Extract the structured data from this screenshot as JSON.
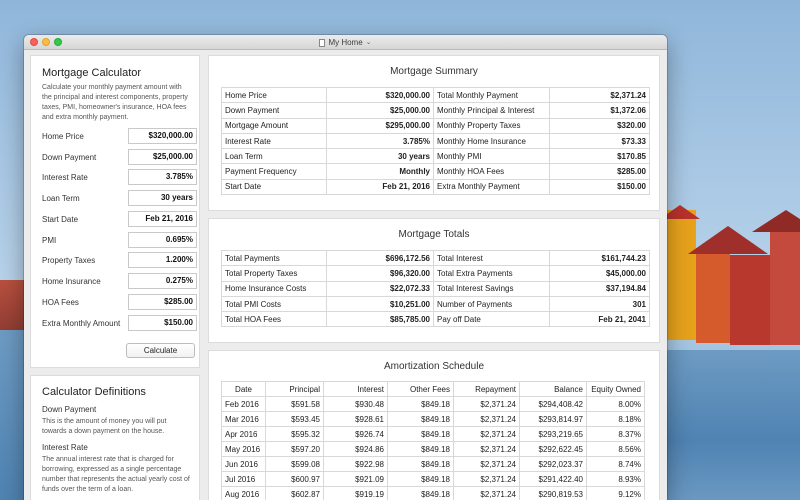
{
  "window": {
    "title": "My Home"
  },
  "calculator": {
    "title": "Mortgage Calculator",
    "description": "Calculate your monthly payment amount with the principal and interest components, property taxes, PMI, homeowner's insurance, HOA fees and extra monthly payment.",
    "fields": [
      {
        "label": "Home Price",
        "value": "$320,000.00"
      },
      {
        "label": "Down Payment",
        "value": "$25,000.00"
      },
      {
        "label": "Interest Rate",
        "value": "3.785%"
      },
      {
        "label": "Loan Term",
        "value": "30 years"
      },
      {
        "label": "Start Date",
        "value": "Feb 21, 2016"
      },
      {
        "label": "PMI",
        "value": "0.695%"
      },
      {
        "label": "Property Taxes",
        "value": "1.200%"
      },
      {
        "label": "Home Insurance",
        "value": "0.275%"
      },
      {
        "label": "HOA Fees",
        "value": "$285.00"
      },
      {
        "label": "Extra Monthly Amount",
        "value": "$150.00"
      }
    ],
    "button_label": "Calculate"
  },
  "definitions": {
    "title": "Calculator Definitions",
    "items": [
      {
        "term": "Down Payment",
        "text": "This is the amount of money you will put towards a down payment on the house."
      },
      {
        "term": "Interest Rate",
        "text": "The annual interest rate that is charged for borrowing, expressed as a single percentage number that represents the actual yearly cost of funds over the term of a loan."
      }
    ]
  },
  "summary": {
    "title": "Mortgage Summary",
    "rows": [
      [
        "Home Price",
        "$320,000.00",
        "Total Monthly Payment",
        "$2,371.24"
      ],
      [
        "Down Payment",
        "$25,000.00",
        "Monthly Principal & Interest",
        "$1,372.06"
      ],
      [
        "Mortgage Amount",
        "$295,000.00",
        "Monthly Property Taxes",
        "$320.00"
      ],
      [
        "Interest Rate",
        "3.785%",
        "Monthly Home Insurance",
        "$73.33"
      ],
      [
        "Loan Term",
        "30 years",
        "Monthly PMI",
        "$170.85"
      ],
      [
        "Payment Frequency",
        "Monthly",
        "Monthly HOA Fees",
        "$285.00"
      ],
      [
        "Start Date",
        "Feb 21, 2016",
        "Extra Monthly Payment",
        "$150.00"
      ]
    ]
  },
  "totals": {
    "title": "Mortgage Totals",
    "rows": [
      [
        "Total Payments",
        "$696,172.56",
        "Total Interest",
        "$161,744.23"
      ],
      [
        "Total Property Taxes",
        "$96,320.00",
        "Total Extra Payments",
        "$45,000.00"
      ],
      [
        "Home Insurance Costs",
        "$22,072.33",
        "Total Interest Savings",
        "$37,194.84"
      ],
      [
        "Total PMI Costs",
        "$10,251.00",
        "Number of Payments",
        "301"
      ],
      [
        "Total HOA Fees",
        "$85,785.00",
        "Pay off Date",
        "Feb 21, 2041"
      ]
    ]
  },
  "amortization": {
    "title": "Amortization Schedule",
    "headers": [
      "Date",
      "Principal",
      "Interest",
      "Other Fees",
      "Repayment",
      "Balance",
      "Equity Owned"
    ],
    "rows": [
      [
        "Feb 2016",
        "$591.58",
        "$930.48",
        "$849.18",
        "$2,371.24",
        "$294,408.42",
        "8.00%"
      ],
      [
        "Mar 2016",
        "$593.45",
        "$928.61",
        "$849.18",
        "$2,371.24",
        "$293,814.97",
        "8.18%"
      ],
      [
        "Apr 2016",
        "$595.32",
        "$926.74",
        "$849.18",
        "$2,371.24",
        "$293,219.65",
        "8.37%"
      ],
      [
        "May 2016",
        "$597.20",
        "$924.86",
        "$849.18",
        "$2,371.24",
        "$292,622.45",
        "8.56%"
      ],
      [
        "Jun 2016",
        "$599.08",
        "$922.98",
        "$849.18",
        "$2,371.24",
        "$292,023.37",
        "8.74%"
      ],
      [
        "Jul 2016",
        "$600.97",
        "$921.09",
        "$849.18",
        "$2,371.24",
        "$291,422.40",
        "8.93%"
      ],
      [
        "Aug 2016",
        "$602.87",
        "$919.19",
        "$849.18",
        "$2,371.24",
        "$290,819.53",
        "9.12%"
      ]
    ]
  }
}
